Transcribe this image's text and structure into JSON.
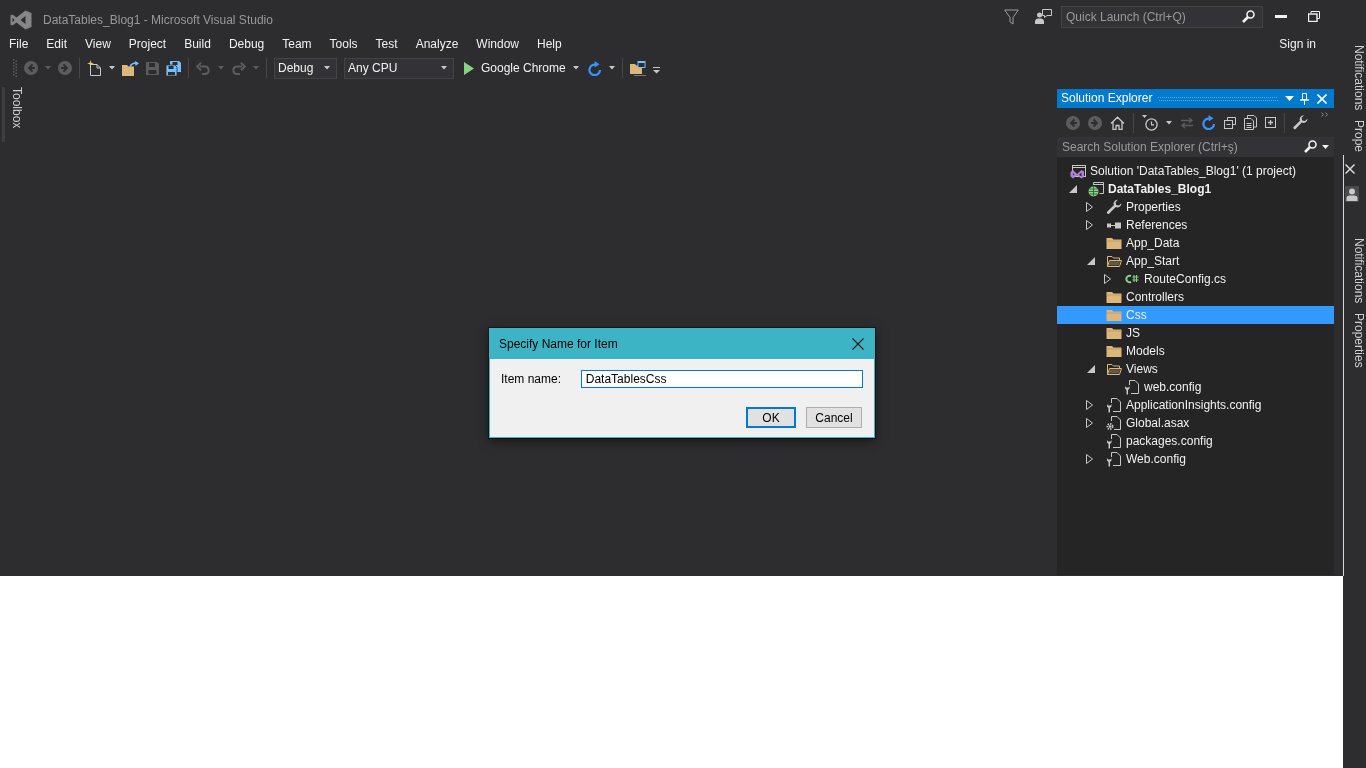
{
  "window": {
    "title": "DataTables_Blog1 - Microsoft Visual Studio"
  },
  "quick_launch": {
    "placeholder": "Quick Launch (Ctrl+Q)"
  },
  "menu": [
    "File",
    "Edit",
    "View",
    "Project",
    "Build",
    "Debug",
    "Team",
    "Tools",
    "Test",
    "Analyze",
    "Window",
    "Help"
  ],
  "account": {
    "label": "Sign in"
  },
  "toolbar": [
    {
      "kind": "grip"
    },
    {
      "kind": "back",
      "disabled": true
    },
    {
      "kind": "dropdown",
      "disabled": true
    },
    {
      "kind": "forward",
      "disabled": true
    },
    {
      "kind": "separator"
    },
    {
      "kind": "new",
      "disabled": false
    },
    {
      "kind": "dropdown",
      "disabled": false
    },
    {
      "kind": "open",
      "disabled": false
    },
    {
      "kind": "save",
      "disabled": true
    },
    {
      "kind": "save-all",
      "disabled": false
    },
    {
      "kind": "separator"
    },
    {
      "kind": "undo",
      "disabled": true
    },
    {
      "kind": "dropdown",
      "disabled": true
    },
    {
      "kind": "redo",
      "disabled": true
    },
    {
      "kind": "dropdown",
      "disabled": true
    },
    {
      "kind": "separator"
    },
    {
      "kind": "combo",
      "value": "Debug",
      "disabled": false
    },
    {
      "kind": "combo",
      "value": "Any CPU",
      "disabled": false
    },
    {
      "kind": "start",
      "label": "Google Chrome",
      "disabled": false
    },
    {
      "kind": "refresh",
      "disabled": false
    },
    {
      "kind": "dropdown",
      "disabled": false
    },
    {
      "kind": "separator"
    },
    {
      "kind": "browse",
      "disabled": false
    },
    {
      "kind": "overflow"
    }
  ],
  "left_tabs": [
    {
      "label": "Toolbox"
    }
  ],
  "solution_explorer": {
    "title": "Solution Explorer",
    "toolbar": [
      {
        "kind": "back",
        "disabled": true
      },
      {
        "kind": "forward",
        "disabled": true
      },
      {
        "kind": "home",
        "disabled": false
      },
      {
        "kind": "separator"
      },
      {
        "kind": "history",
        "disabled": false
      },
      {
        "kind": "dropdown",
        "disabled": false
      },
      {
        "kind": "sync",
        "disabled": true
      },
      {
        "kind": "refresh",
        "disabled": false
      },
      {
        "kind": "collapse",
        "disabled": false
      },
      {
        "kind": "copy",
        "disabled": false
      },
      {
        "kind": "add",
        "disabled": false
      },
      {
        "kind": "separator"
      },
      {
        "kind": "wrench",
        "disabled": false
      },
      {
        "kind": "overflow"
      }
    ],
    "search": {
      "placeholder": "Search Solution Explorer (Ctrl+ş)"
    },
    "tree": [
      {
        "kind": "solution",
        "label": "Solution 'DataTables_Blog1' (1 project)",
        "selected": false,
        "children": [
          {
            "kind": "project",
            "label": "DataTables_Blog1",
            "expanded": true,
            "selected": false,
            "children": [
              {
                "kind": "properties",
                "label": "Properties",
                "expanded": false,
                "selected": false
              },
              {
                "kind": "references",
                "label": "References",
                "expanded": false,
                "selected": false
              },
              {
                "kind": "folder",
                "label": "App_Data",
                "selected": false
              },
              {
                "kind": "folder",
                "label": "App_Start",
                "expanded": true,
                "selected": false,
                "children": [
                  {
                    "kind": "code",
                    "label": "RouteConfig.cs",
                    "expanded": false,
                    "selected": false
                  }
                ]
              },
              {
                "kind": "folder",
                "label": "Controllers",
                "selected": false
              },
              {
                "kind": "folder",
                "label": "Css",
                "selected": true
              },
              {
                "kind": "folder",
                "label": "JS",
                "selected": false
              },
              {
                "kind": "folder",
                "label": "Models",
                "selected": false
              },
              {
                "kind": "folder",
                "label": "Views",
                "expanded": true,
                "selected": false,
                "children": [
                  {
                    "kind": "config",
                    "label": "web.config",
                    "selected": false
                  }
                ]
              },
              {
                "kind": "config",
                "label": "ApplicationInsights.config",
                "expanded": false,
                "selected": false
              },
              {
                "kind": "asax",
                "label": "Global.asax",
                "expanded": false,
                "selected": false
              },
              {
                "kind": "config",
                "label": "packages.config",
                "selected": false
              },
              {
                "kind": "config",
                "label": "Web.config",
                "expanded": false,
                "selected": false
              }
            ]
          }
        ]
      }
    ]
  },
  "side_bar": [
    {
      "items": [
        {
          "kind": "tab",
          "label": "Notifications"
        },
        {
          "kind": "tab",
          "label": "Prope"
        }
      ]
    },
    {
      "items": [
        {
          "kind": "close"
        },
        {
          "kind": "account"
        },
        {
          "kind": "tab",
          "label": "Notifications"
        },
        {
          "kind": "tab",
          "label": "Properties"
        }
      ]
    }
  ],
  "dialog": {
    "title": "Specify Name for Item",
    "label": "Item name:",
    "value": "DataTablesCss",
    "buttons": [
      {
        "label": "OK",
        "default": true
      },
      {
        "label": "Cancel",
        "default": false
      }
    ]
  }
}
